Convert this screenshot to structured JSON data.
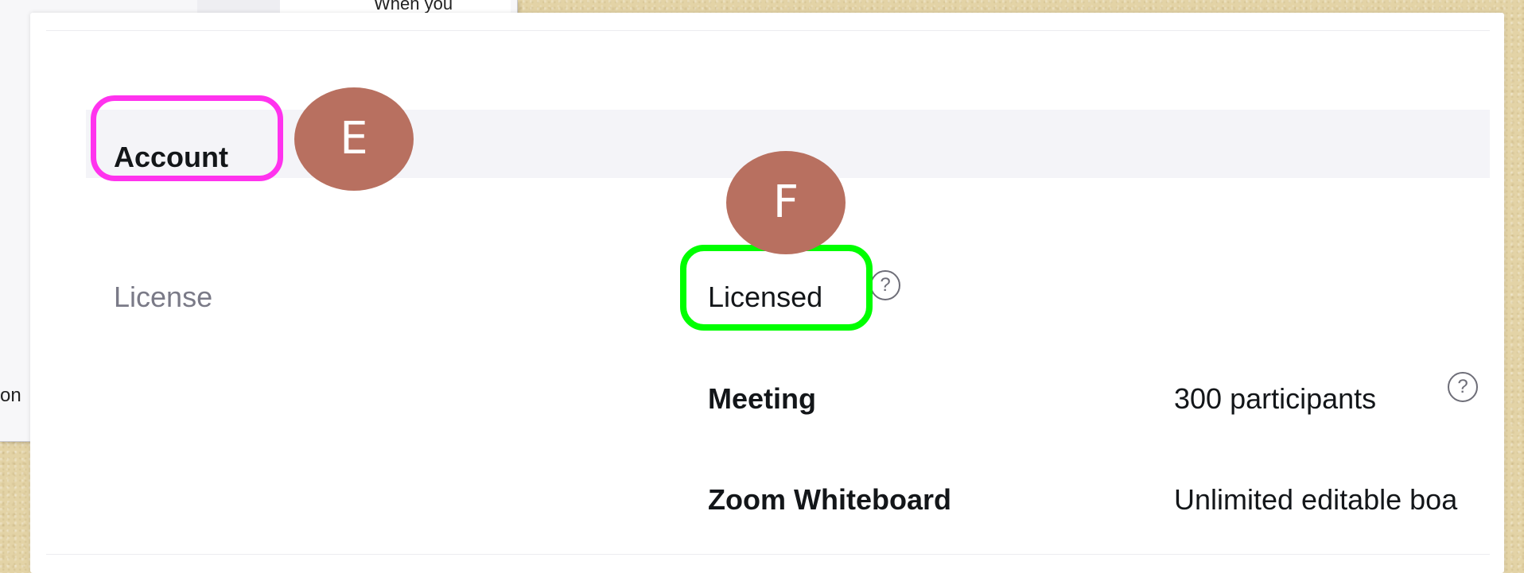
{
  "background_window": {
    "top_snippet": "When you",
    "left_snippet": "on"
  },
  "section": {
    "title": "Account"
  },
  "license_row": {
    "label": "License",
    "value": "Licensed",
    "help_icon": "question-circle-icon"
  },
  "features": [
    {
      "name": "Meeting",
      "value": "300 participants",
      "help_icon": "question-circle-icon"
    },
    {
      "name": "Zoom Whiteboard",
      "value": "Unlimited editable boa"
    }
  ],
  "annotations": {
    "markers": [
      {
        "label": "E",
        "color": "#b87060"
      },
      {
        "label": "F",
        "color": "#b87060"
      }
    ],
    "highlight_colors": {
      "account": "#ff33ee",
      "licensed": "#00ff00"
    }
  },
  "colors": {
    "text_primary": "#131619",
    "text_secondary": "#7a7a87",
    "section_header_bg": "#f4f4f8"
  }
}
